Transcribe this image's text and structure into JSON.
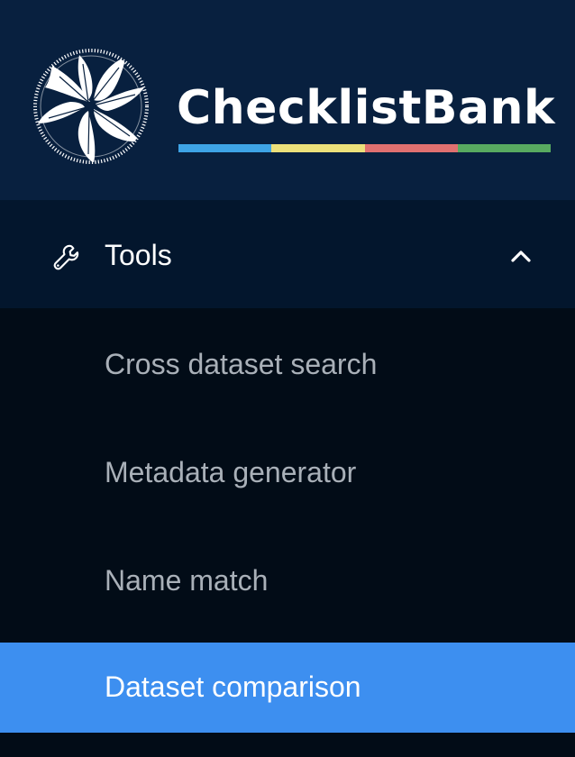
{
  "brand": {
    "name": "ChecklistBank",
    "bar_colors": [
      "#3ea4e6",
      "#ece07a",
      "#e07070",
      "#58aa60"
    ]
  },
  "menu": {
    "title": "Tools",
    "icon": "wrench-icon",
    "expanded": true,
    "items": [
      {
        "label": "Cross dataset search",
        "active": false
      },
      {
        "label": "Metadata generator",
        "active": false
      },
      {
        "label": "Name match",
        "active": false
      },
      {
        "label": "Dataset comparison",
        "active": true
      }
    ]
  },
  "colors": {
    "logo_bg": "#08203f",
    "menu_header_bg": "#03162d",
    "submenu_bg": "#020c17",
    "active_item_bg": "#3d8ff0",
    "inactive_text": "#a9b0b8"
  }
}
